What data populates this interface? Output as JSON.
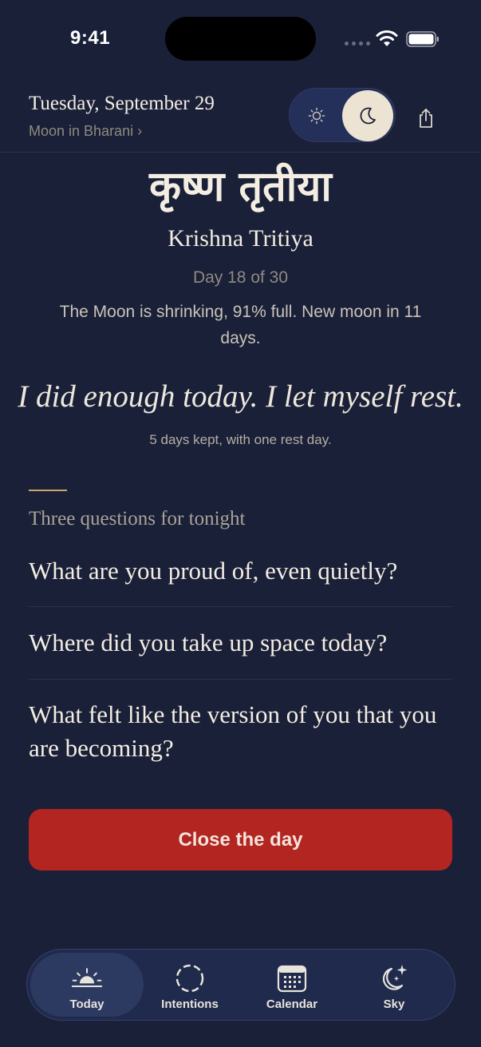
{
  "status_bar": {
    "time": "9:41"
  },
  "header": {
    "date": "Tuesday, September 29",
    "subtitle": "Moon in Bharani ›"
  },
  "theme_toggle": {
    "light_icon": "sun-icon",
    "dark_icon": "moon-icon",
    "selected": "dark"
  },
  "share": {
    "icon": "share-icon"
  },
  "tithi": {
    "sanskrit": "कृष्ण तृतीया",
    "name": "Krishna Tritiya",
    "day_count": "Day 18 of 30",
    "moon_description": "The Moon is shrinking, 91% full. New moon in 11 days."
  },
  "affirmation": "I did enough today. I let myself rest.",
  "streak": "5 days kept, with one rest day.",
  "questions": {
    "heading": "Three questions for tonight",
    "items": [
      "What are you proud of, even quietly?",
      "Where did you take up space today?",
      "What felt like the version of you that you are becoming?"
    ]
  },
  "close_button": "Close the day",
  "tab_bar": {
    "tabs": [
      {
        "label": "Today",
        "icon": "sunrise-icon",
        "active": true
      },
      {
        "label": "Intentions",
        "icon": "dashed-circle-icon",
        "active": false
      },
      {
        "label": "Calendar",
        "icon": "calendar-icon",
        "active": false
      },
      {
        "label": "Sky",
        "icon": "moon-stars-icon",
        "active": false
      }
    ]
  },
  "colors": {
    "background": "#1a2038",
    "accent_red": "#b22521",
    "accent_gold": "#c8a86b",
    "toggle_active": "#ece3d2"
  }
}
